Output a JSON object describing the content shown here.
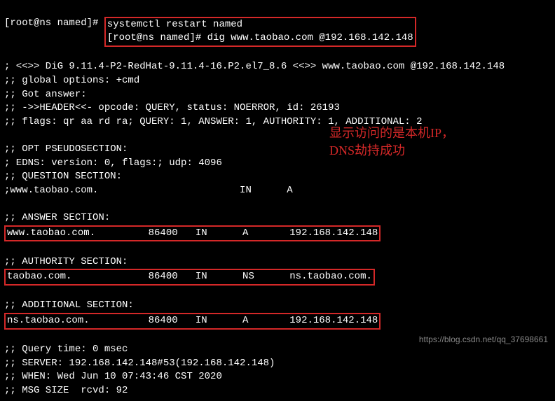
{
  "prompt_prefix": "[root@ns named]# ",
  "cmd1": "systemctl restart named",
  "cmd2": "dig www.taobao.com @192.168.142.148",
  "blank": "",
  "dig_banner": "; <<>> DiG 9.11.4-P2-RedHat-9.11.4-16.P2.el7_8.6 <<>> www.taobao.com @192.168.142.148",
  "global_opts": ";; global options: +cmd",
  "got_answer": ";; Got answer:",
  "header": ";; ->>HEADER<<- opcode: QUERY, status: NOERROR, id: 26193",
  "flags": ";; flags: qr aa rd ra; QUERY: 1, ANSWER: 1, AUTHORITY: 1, ADDITIONAL: 2",
  "opt_hdr": ";; OPT PSEUDOSECTION:",
  "edns": "; EDNS: version: 0, flags:; udp: 4096",
  "question_hdr": ";; QUESTION SECTION:",
  "question_row": ";www.taobao.com.                        IN      A",
  "answer_hdr": ";; ANSWER SECTION:",
  "answer_row": "www.taobao.com.         86400   IN      A       192.168.142.148",
  "authority_hdr": ";; AUTHORITY SECTION:",
  "authority_row": "taobao.com.             86400   IN      NS      ns.taobao.com.",
  "additional_hdr": ";; ADDITIONAL SECTION:",
  "additional_row": "ns.taobao.com.          86400   IN      A       192.168.142.148",
  "query_time": ";; Query time: 0 msec",
  "server": ";; SERVER: 192.168.142.148#53(192.168.142.148)",
  "when": ";; WHEN: Wed Jun 10 07:43:46 CST 2020",
  "msg_size": ";; MSG SIZE  rcvd: 92",
  "annot_line1": "显示访问的是本机IP，",
  "annot_line2": "DNS劫持成功",
  "watermark": "https://blog.csdn.net/qq_37698661"
}
